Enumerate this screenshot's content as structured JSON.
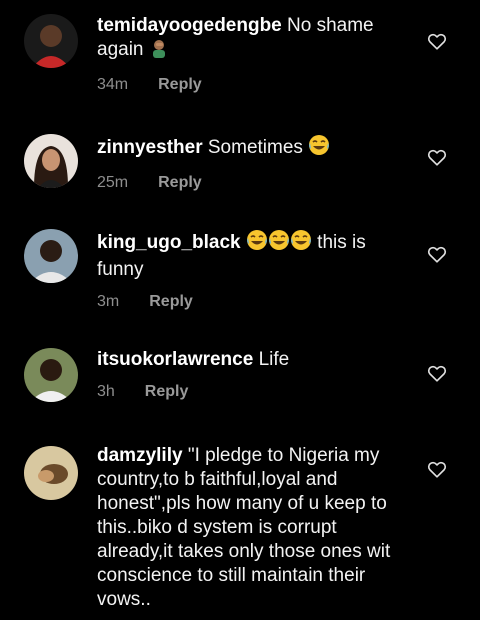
{
  "comments": [
    {
      "username": "temidayoogedengbe",
      "text": "No shame again",
      "emoji": "man-facepalming",
      "time": "34m",
      "reply": "Reply",
      "avatar_color": "#c62828"
    },
    {
      "username": "zinnyesther",
      "text": "Sometimes",
      "emoji": "laughing-tears",
      "time": "25m",
      "reply": "Reply",
      "avatar_color": "#e8d8d0"
    },
    {
      "username": "king_ugo_black",
      "text": "this is funny",
      "emoji": "laughing-tears-x3",
      "time": "3m",
      "reply": "Reply",
      "avatar_color": "#2a2a2a"
    },
    {
      "username": "itsuokorlawrence",
      "text": "Life",
      "time": "3h",
      "reply": "Reply",
      "avatar_color": "#3a4a2a"
    },
    {
      "username": "damzylily",
      "text": "\"I pledge to Nigeria my country,to b faithful,loyal and honest\",pls how many of u keep to this..biko d system is corrupt already,it takes only those ones wit conscience to still maintain their vows..",
      "avatar_color": "#b8a070"
    }
  ],
  "icons": {
    "like": "heart-outline-icon",
    "laugh": "face-with-tears-of-joy-icon",
    "facepalm": "man-facepalming-icon"
  },
  "colors": {
    "background": "#000000",
    "text": "#f3f3f3",
    "meta": "#8e8e8e",
    "emoji_yellow": "#f7c52e"
  }
}
